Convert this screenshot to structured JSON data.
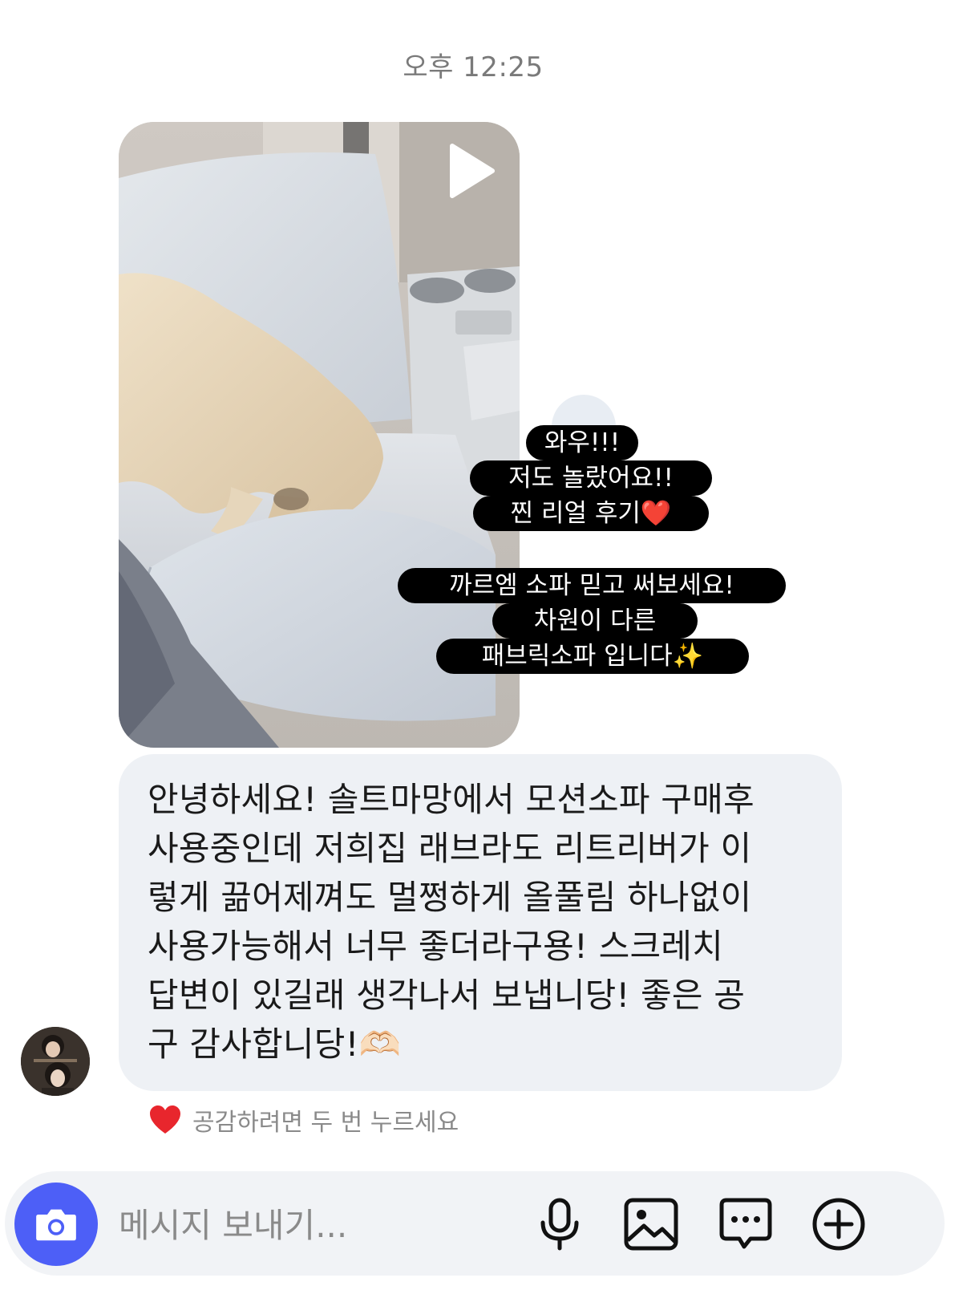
{
  "timestamp": "오후 12:25",
  "story": {
    "captions": [
      "와우!!!",
      "저도 놀랐어요!!",
      "찐 리얼 후기❤️",
      "까르엠 소파 믿고 써보세요!",
      "차원이 다른",
      "패브릭소파 입니다✨"
    ],
    "play_icon": "play-icon"
  },
  "message": {
    "text": "안녕하세요! 솔트마망에서 모션소파 구매후\n사용중인데 저희집 래브라도 리트리버가 이\n렇게 끎어제껴도 멀쩡하게 올풀림 하나없이\n사용가능해서 너무 좋더라구용! 스크레치\n답변이 있길래 생각나서 보냅니당! 좋은 공\n구 감사합니당!🫶🏻"
  },
  "reaction_hint": {
    "icon": "heart-icon",
    "text": "공감하려면 두 번 누르세요"
  },
  "composer": {
    "placeholder": "메시지 보내기...",
    "icons": [
      "camera-icon",
      "microphone-icon",
      "image-icon",
      "chat-icon",
      "plus-circle-icon"
    ]
  },
  "colors": {
    "camera_button": "#4d5ff7",
    "bubble": "#eef1f5",
    "caption_pill": "#000000",
    "heart": "#e8262d"
  }
}
